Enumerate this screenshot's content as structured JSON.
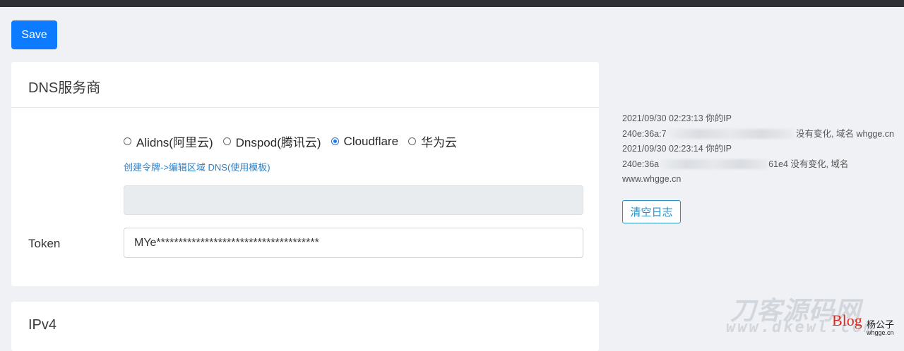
{
  "toolbar": {
    "save_label": "Save"
  },
  "dns_card": {
    "title": "DNS服务商",
    "providers": [
      {
        "label": "Alidns(阿里云)",
        "checked": false
      },
      {
        "label": "Dnspod(腾讯云)",
        "checked": false
      },
      {
        "label": "Cloudflare",
        "checked": true
      },
      {
        "label": "华为云",
        "checked": false
      }
    ],
    "help_link": "创建令牌->编辑区域 DNS(使用模板)",
    "token_label": "Token",
    "token_value": "MYe*************************************"
  },
  "ipv4_card": {
    "title": "IPv4"
  },
  "log": {
    "entries": [
      {
        "time_line": "2021/09/30 02:23:13 你的IP",
        "ip_prefix": "240e:36a:7",
        "ip_suffix": "",
        "message": "没有变化, 域名 whgge.cn"
      },
      {
        "time_line": "2021/09/30 02:23:14 你的IP",
        "ip_prefix": "240e:36a",
        "ip_suffix": "61e4",
        "message": "没有变化, 域名",
        "domain": "www.whgge.cn"
      }
    ],
    "clear_label": "清空日志"
  },
  "watermark": {
    "main": "刀客源码网",
    "url": "www.dkewl.com",
    "blog": "Blog",
    "name": "杨公子",
    "site": "whgge.cn"
  }
}
